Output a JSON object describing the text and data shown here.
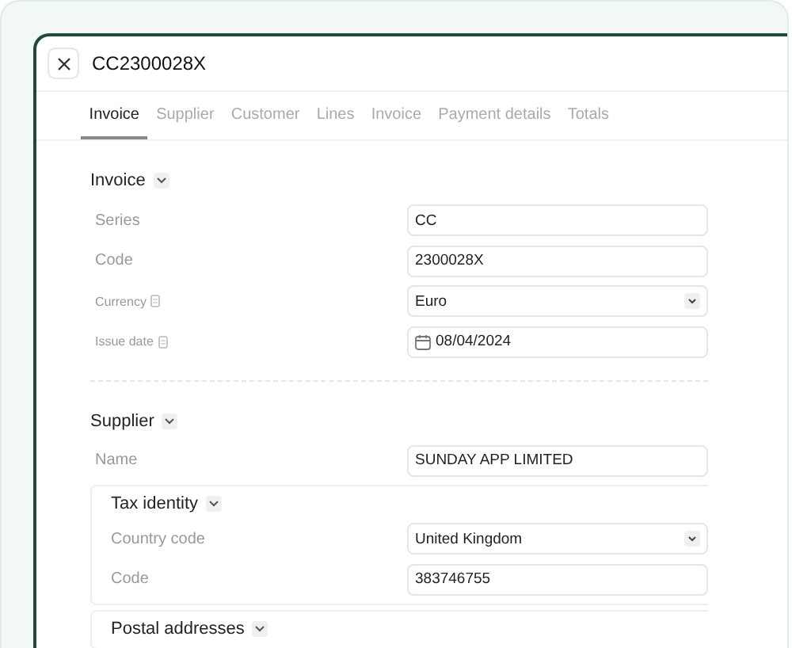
{
  "window": {
    "title": "CC2300028X"
  },
  "tabs": [
    {
      "label": "Invoice",
      "selected": true
    },
    {
      "label": "Supplier",
      "selected": false
    },
    {
      "label": "Customer",
      "selected": false
    },
    {
      "label": "Lines",
      "selected": false
    },
    {
      "label": "Invoice",
      "selected": false
    },
    {
      "label": "Payment details",
      "selected": false
    },
    {
      "label": "Totals",
      "selected": false
    }
  ],
  "sections": [
    {
      "title": "Invoice",
      "fields": [
        {
          "label": "Series",
          "kind": "text",
          "value": "CC",
          "hint_icon": false
        },
        {
          "label": "Code",
          "kind": "text",
          "value": "2300028X",
          "hint_icon": false
        },
        {
          "label": "Currency",
          "kind": "select",
          "value": "Euro",
          "hint_icon": true
        },
        {
          "label": "Issue date",
          "kind": "date",
          "value": "08/04/2024",
          "hint_icon": true
        }
      ]
    },
    {
      "title": "Supplier",
      "fields": [
        {
          "label": "Name",
          "kind": "text",
          "value": "SUNDAY APP LIMITED",
          "hint_icon": false
        }
      ],
      "groups": [
        {
          "title": "Tax identity",
          "fields": [
            {
              "label": "Country code",
              "kind": "select",
              "value": "United Kingdom",
              "hint_icon": false
            },
            {
              "label": "Code",
              "kind": "text",
              "value": "383746755",
              "hint_icon": false
            }
          ]
        },
        {
          "title": "Postal addresses"
        }
      ]
    }
  ]
}
